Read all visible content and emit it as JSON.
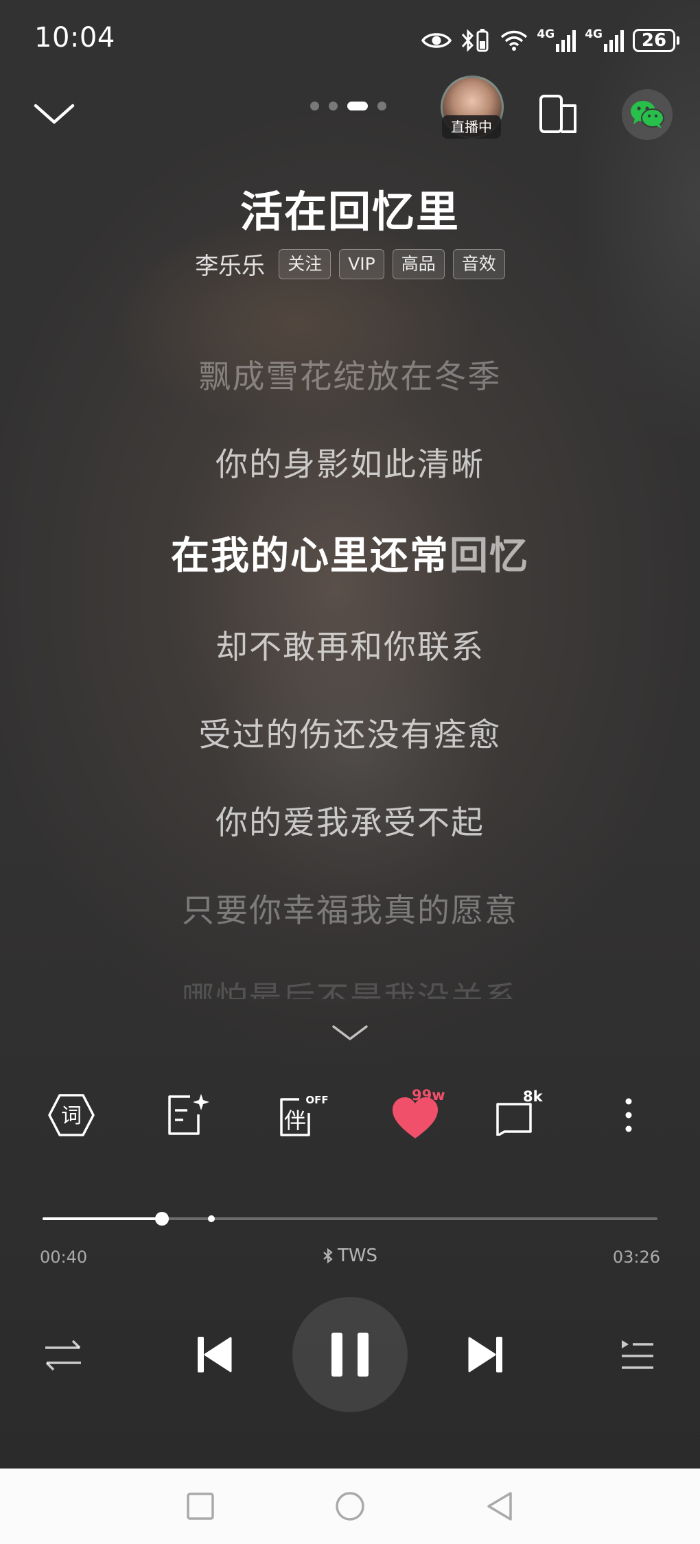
{
  "status_bar": {
    "time": "10:04",
    "network_1": "4G",
    "network_2": "4G",
    "battery": "26"
  },
  "top_bar": {
    "live_label": "直播中",
    "page_count": 4,
    "active_page": 3
  },
  "song": {
    "title": "活在回忆里",
    "artist": "李乐乐",
    "tags": [
      "关注",
      "VIP",
      "高品",
      "音效"
    ]
  },
  "lyrics": {
    "previous_2": "飘成雪花绽放在冬季",
    "previous_1": "你的身影如此清晰",
    "current_sung": "在我的心里还常",
    "current_rest": "回忆",
    "next_1": "却不敢再和你联系",
    "next_2": "受过的伤还没有痊愈",
    "next_3": "你的爱我承受不起",
    "next_4": "只要你幸福我真的愿意",
    "next_5": "哪怕最后不是我没关系"
  },
  "actions": {
    "lyrics_icon_glyph": "词",
    "accompany_glyph": "伴",
    "accompany_state": "OFF",
    "like_count": "99w",
    "comment_count": "8k"
  },
  "playback": {
    "elapsed": "00:40",
    "duration": "03:26",
    "output_device": "TWS",
    "progress_fraction": 0.194,
    "highlight_marker_fraction": 0.275
  },
  "colors": {
    "like": "#f0506a",
    "wechat": "#27c04a",
    "navbar": "#fbfbfb"
  }
}
